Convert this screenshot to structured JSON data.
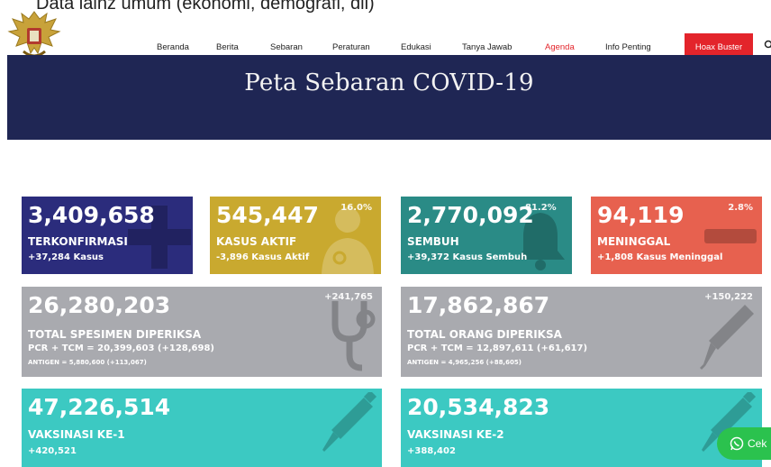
{
  "caption": "Data lainz umum (ekonomi, demografi, dll)",
  "nav": {
    "items": [
      "Beranda",
      "Berita",
      "Sebaran",
      "Peraturan",
      "Edukasi",
      "Tanya Jawab",
      "Agenda",
      "Info Penting"
    ],
    "active_item": "Agenda",
    "hoax_label": "Hoax Buster"
  },
  "banner": {
    "title": "Peta Sebaran COVID-19"
  },
  "stats": {
    "confirmed": {
      "value": "3,409,658",
      "label": "TERKONFIRMASI",
      "sub": "+37,284 Kasus"
    },
    "active": {
      "value": "545,447",
      "label": "KASUS AKTIF",
      "sub": "-3,896 Kasus Aktif",
      "pct": "16.0%"
    },
    "recovered": {
      "value": "2,770,092",
      "label": "SEMBUH",
      "sub": "+39,372 Kasus Sembuh",
      "pct": "81.2%"
    },
    "deaths": {
      "value": "94,119",
      "label": "MENINGGAL",
      "sub": "+1,808 Kasus Meninggal",
      "pct": "2.8%"
    },
    "specimens": {
      "value": "26,280,203",
      "label": "TOTAL SPESIMEN DIPERIKSA",
      "sub": "PCR + TCM = 20,399,603 (+128,698)",
      "sub2": "ANTIGEN = 5,880,600 (+113,067)",
      "delta": "+241,765"
    },
    "people": {
      "value": "17,862,867",
      "label": "TOTAL ORANG DIPERIKSA",
      "sub": "PCR + TCM = 12,897,611 (+61,617)",
      "sub2": "ANTIGEN = 4,965,256 (+88,605)",
      "delta": "+150,222"
    },
    "vaccine1": {
      "value": "47,226,514",
      "label": "VAKSINASI KE-1",
      "sub": "+420,521"
    },
    "vaccine2": {
      "value": "20,534,823",
      "label": "VAKSINASI KE-2",
      "sub": "+388,402"
    }
  },
  "chat": {
    "label": "Cek"
  },
  "colors": {
    "navy": "#1f2654",
    "confirmed": "#2b2c7c",
    "active": "#c9a92f",
    "recovered": "#2a8b86",
    "deaths": "#e7614f",
    "tests": "#a9aaaf",
    "vaccine": "#3cc9c2",
    "accent_red": "#e3242b",
    "whatsapp": "#2bc24e"
  },
  "icons": [
    "garuda-emblem-icon",
    "search-icon",
    "plus-icon",
    "doctor-icon",
    "bell-icon",
    "minus-icon",
    "stethoscope-icon",
    "thermometer-icon",
    "syringe-icon",
    "whatsapp-icon"
  ]
}
